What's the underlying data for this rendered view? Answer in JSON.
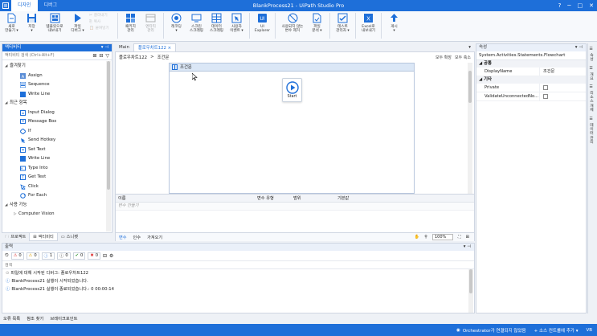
{
  "title_bar": {
    "tabs": [
      "디자인",
      "디버그"
    ],
    "title": "BlankProcess21 - UiPath Studio Pro"
  },
  "ribbon": {
    "buttons": [
      {
        "label": "새로\n만들기 ▾",
        "icon": "new-file-icon"
      },
      {
        "label": "저장\n▾",
        "icon": "save-icon"
      },
      {
        "label": "템플릿으로\n내보내기",
        "icon": "template-export-icon"
      },
      {
        "label": "파일\n디버그 ▾",
        "icon": "run-icon"
      }
    ],
    "clipboard": [
      "잘라내기",
      "복사",
      "붙여넣기"
    ],
    "buttons2": [
      {
        "label": "패키지\n관리",
        "icon": "package-icon"
      },
      {
        "label": "엔티티\n관리",
        "icon": "entity-icon",
        "disabled": true
      },
      {
        "label": "레코딩\n▾",
        "icon": "record-icon"
      },
      {
        "label": "스크린\n스크래핑",
        "icon": "screen-scrape-icon"
      },
      {
        "label": "데이터\n스크래핑",
        "icon": "data-scrape-icon"
      },
      {
        "label": "사용자\n이벤트 ▾",
        "icon": "user-events-icon"
      },
      {
        "label": "UI\nExplorer",
        "icon": "ui-explorer-icon"
      },
      {
        "label": "사용되지 않는\n변수 제거",
        "icon": "remove-vars-icon"
      },
      {
        "label": "파일\n분석 ▾",
        "icon": "analyze-icon"
      },
      {
        "label": "테스트\n관리자 ▾",
        "icon": "test-manager-icon"
      },
      {
        "label": "Excel로\n내보내기",
        "icon": "excel-icon"
      },
      {
        "label": "게시\n▾",
        "icon": "publish-icon"
      }
    ]
  },
  "activities_panel": {
    "title": "액티비티",
    "search_placeholder": "액티비티 검색 (Ctrl+Alt+F)",
    "favorites_header": "즐겨찾기",
    "favorites": [
      "Assign",
      "Sequence",
      "Write Line"
    ],
    "recent_header": "최근 항목",
    "recent": [
      "Input Dialog",
      "Message Box",
      "If",
      "Send Hotkey",
      "Set Text",
      "Write Line",
      "Type Into",
      "Get Text",
      "Click",
      "For Each"
    ],
    "available_header": "사용 가능",
    "available": [
      "Computer Vision"
    ],
    "tabs": [
      "프로젝트",
      "액티비티",
      "스니펫"
    ]
  },
  "designer": {
    "doc_tabs": [
      "Main",
      "플로우차트122 ×"
    ],
    "breadcrumb": [
      "플로우차트122",
      ">",
      "조건문"
    ],
    "expand_all": "모두 확장",
    "collapse_all": "모두 축소",
    "flowchart_title": "조건문",
    "start_label": "Start",
    "var_columns": [
      "이름",
      "변수 유형",
      "범위",
      "기본값"
    ],
    "var_create": "변수 만들기",
    "footer_tabs": [
      "변수",
      "인수",
      "가져오기"
    ],
    "zoom": "100%"
  },
  "properties": {
    "title": "속성",
    "type_name": "System.Activities.Statements.Flowchart",
    "cat_common": "공통",
    "display_name_key": "DisplayName",
    "display_name_val": "조건문",
    "cat_misc": "기타",
    "private_key": "Private",
    "validate_key": "ValidateUnconnectedNo..."
  },
  "right_strip": [
    "속성",
    "개요",
    "리소스 개체",
    "데이터 관리"
  ],
  "output": {
    "title": "출력",
    "counts": [
      "0",
      "0",
      "1",
      "0",
      "0"
    ],
    "search_placeholder": "검색",
    "lines": [
      "파일에 대해 시작된 디버그: 플로우차트122",
      "BlankProcess21 실행이 시작되었습니다.",
      "BlankProcess21 실행이 종료되었습니다.: 0 00:00:14"
    ]
  },
  "bottom_tabs": [
    "오류 목록",
    "참조 찾기",
    "브레이크포인트"
  ],
  "status_bar": {
    "orchestrator": "Orchestrator가 연결되지 않았음",
    "source_control": "+ 소스 컨트롤에 추가 ▾",
    "user": "VB"
  },
  "colors": {
    "brand": "#1e6fd9",
    "run": "#1e6fd9"
  }
}
